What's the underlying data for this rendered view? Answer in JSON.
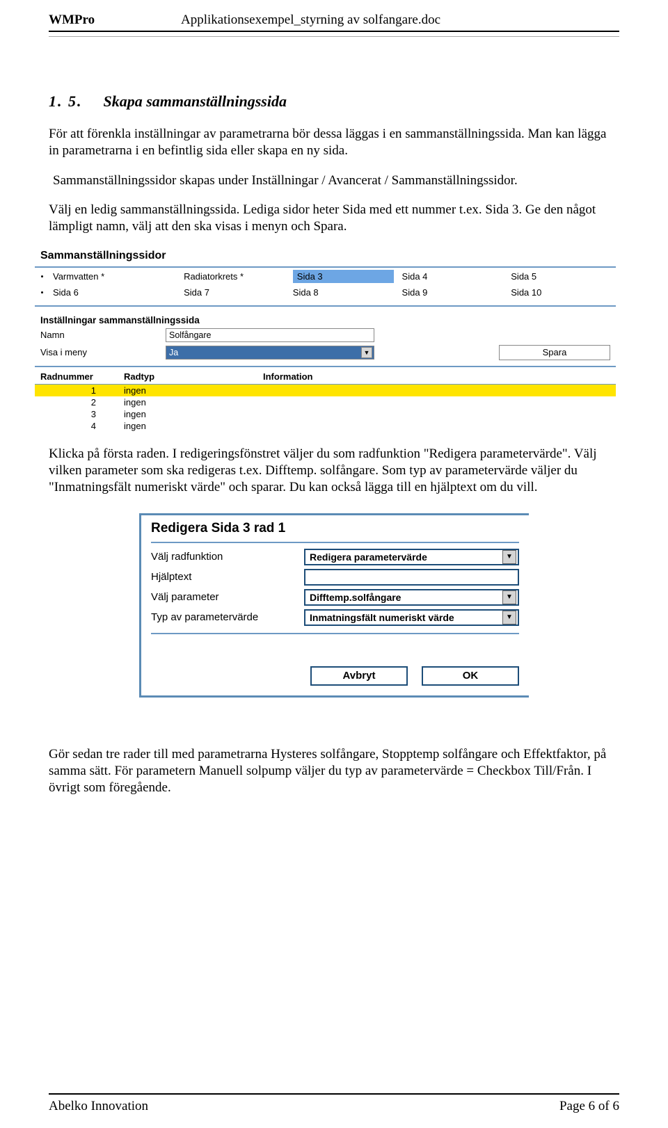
{
  "header": {
    "product": "WMPro",
    "doc_title": "Applikationsexempel_styrning av solfangare.doc"
  },
  "section": {
    "number": "1. 5.",
    "title": "Skapa sammanställningssida"
  },
  "para1": "För att förenkla inställningar av parametrarna bör dessa läggas i en sammanställningssida. Man kan lägga in parametrarna i en befintlig sida eller skapa en ny sida.",
  "para2_line1": "Sammanställningssidor skapas under Inställningar / Avancerat / Sammanställningssidor.",
  "para3": "Välj en ledig sammanställningssida. Lediga sidor heter Sida med ett nummer t.ex. Sida 3. Ge den något lämpligt namn, välj att den ska visas i menyn och Spara.",
  "ss1": {
    "title": "Sammanställningssidor",
    "row1": [
      "Varmvatten *",
      "Radiatorkrets *",
      "Sida 3",
      "Sida 4",
      "Sida 5"
    ],
    "row2": [
      "Sida 6",
      "Sida 7",
      "Sida 8",
      "Sida 9",
      "Sida 10"
    ],
    "section_label": "Inställningar sammanställningssida",
    "name_label": "Namn",
    "name_value": "Solfångare",
    "visa_label": "Visa i meny",
    "visa_value": "Ja",
    "spara": "Spara",
    "th": [
      "Radnummer",
      "Radtyp",
      "Information"
    ],
    "rows": [
      {
        "n": "1",
        "t": "ingen"
      },
      {
        "n": "2",
        "t": "ingen"
      },
      {
        "n": "3",
        "t": "ingen"
      },
      {
        "n": "4",
        "t": "ingen"
      }
    ]
  },
  "para4": "Klicka på första raden. I redigeringsfönstret väljer du som radfunktion \"Redigera parametervärde\". Välj vilken parameter som ska redigeras t.ex. Difftemp. solfångare. Som typ av parametervärde väljer du \"Inmatningsfält numeriskt värde\" och sparar. Du kan också lägga till en hjälptext om du vill.",
  "ss2": {
    "title": "Redigera Sida 3 rad 1",
    "r1_label": "Välj radfunktion",
    "r1_value": "Redigera parametervärde",
    "r2_label": "Hjälptext",
    "r3_label": "Välj parameter",
    "r3_value": "Difftemp.solfångare",
    "r4_label": "Typ av parametervärde",
    "r4_value": "Inmatningsfält numeriskt värde",
    "btn_cancel": "Avbryt",
    "btn_ok": "OK"
  },
  "para5": "Gör sedan tre rader till med parametrarna Hysteres solfångare, Stopptemp solfångare och Effektfaktor, på samma sätt. För parametern Manuell solpump väljer du typ av parametervärde = Checkbox Till/Från. I övrigt som föregående.",
  "footer": {
    "left": "Abelko Innovation",
    "right": "Page 6 of 6"
  }
}
